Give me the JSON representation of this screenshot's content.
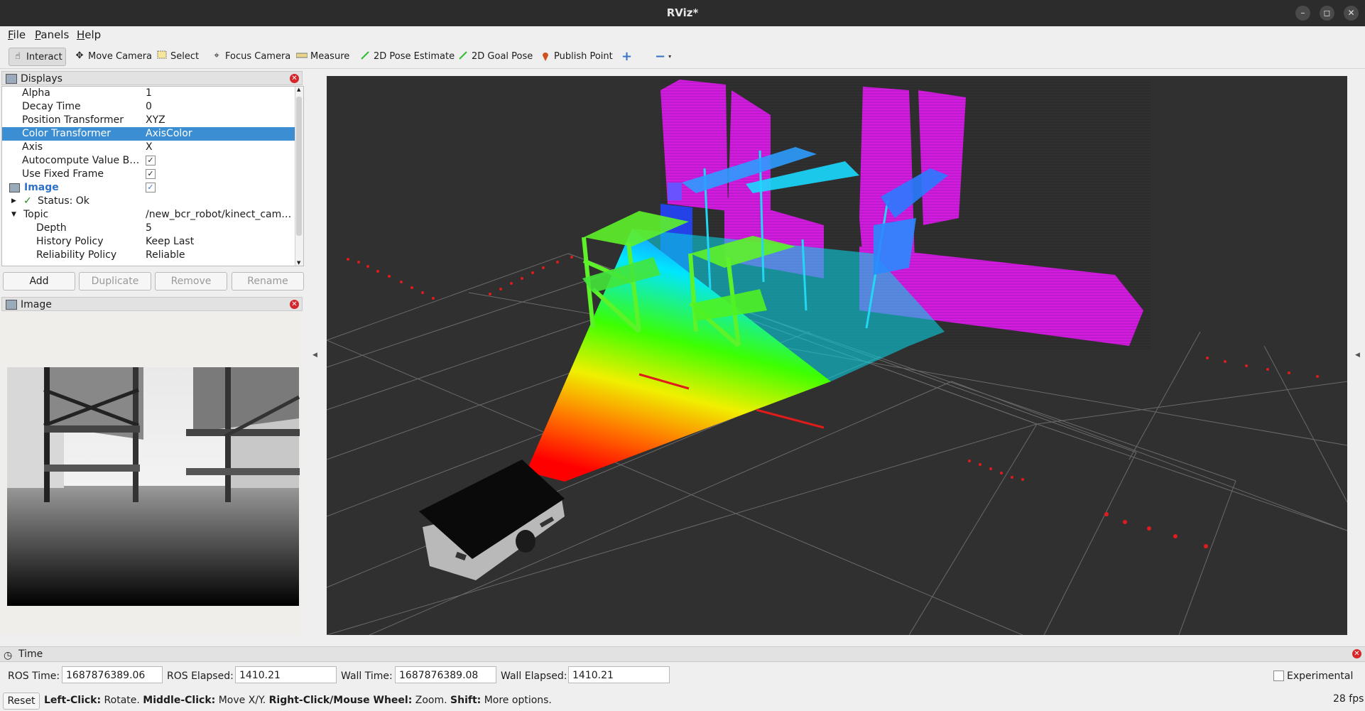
{
  "window": {
    "title": "RViz*",
    "min": "–",
    "max": "◻",
    "close": "✕"
  },
  "menu": [
    {
      "label": "File",
      "key": "F",
      "rest": "ile"
    },
    {
      "label": "Panels",
      "key": "P",
      "rest": "anels"
    },
    {
      "label": "Help",
      "key": "H",
      "rest": "elp"
    }
  ],
  "toolbar": {
    "interact": "Interact",
    "move_camera": "Move Camera",
    "select": "Select",
    "focus_camera": "Focus Camera",
    "measure": "Measure",
    "pose_estimate": "2D Pose Estimate",
    "goal_pose": "2D Goal Pose",
    "publish_point": "Publish Point"
  },
  "displays_panel": {
    "title": "Displays",
    "rows": [
      {
        "name": "Alpha",
        "value": "1"
      },
      {
        "name": "Decay Time",
        "value": "0"
      },
      {
        "name": "Position Transformer",
        "value": "XYZ"
      },
      {
        "name": "Color Transformer",
        "value": "AxisColor"
      },
      {
        "name": "Axis",
        "value": "X"
      },
      {
        "name": "Autocompute Value B…",
        "value": "✓"
      },
      {
        "name": "Use Fixed Frame",
        "value": "✓"
      },
      {
        "name": "Image",
        "value": "✓"
      },
      {
        "name": "Status: Ok",
        "value": ""
      },
      {
        "name": "Topic",
        "value": "/new_bcr_robot/kinect_cam…"
      },
      {
        "name": "Depth",
        "value": "5"
      },
      {
        "name": "History Policy",
        "value": "Keep Last"
      },
      {
        "name": "Reliability Policy",
        "value": "Reliable"
      }
    ],
    "buttons": {
      "add": "Add",
      "duplicate": "Duplicate",
      "remove": "Remove",
      "rename": "Rename"
    }
  },
  "image_panel": {
    "title": "Image"
  },
  "time_panel": {
    "title": "Time",
    "ros_time_label": "ROS Time:",
    "ros_time": "1687876389.06",
    "ros_elapsed_label": "ROS Elapsed:",
    "ros_elapsed": "1410.21",
    "wall_time_label": "Wall Time:",
    "wall_time": "1687876389.08",
    "wall_elapsed_label": "Wall Elapsed:",
    "wall_elapsed": "1410.21",
    "experimental": "Experimental"
  },
  "statusbar": {
    "reset": "Reset",
    "h1": "Left-Click:",
    "t1": " Rotate. ",
    "h2": "Middle-Click:",
    "t2": " Move X/Y. ",
    "h3": "Right-Click/Mouse Wheel:",
    "t3": " Zoom. ",
    "h4": "Shift:",
    "t4": " More options.",
    "fps": "28 fps"
  },
  "colors": {
    "selection": "#3b8ed2",
    "viewport_bg": "#303030",
    "close_red": "#d7262b"
  }
}
